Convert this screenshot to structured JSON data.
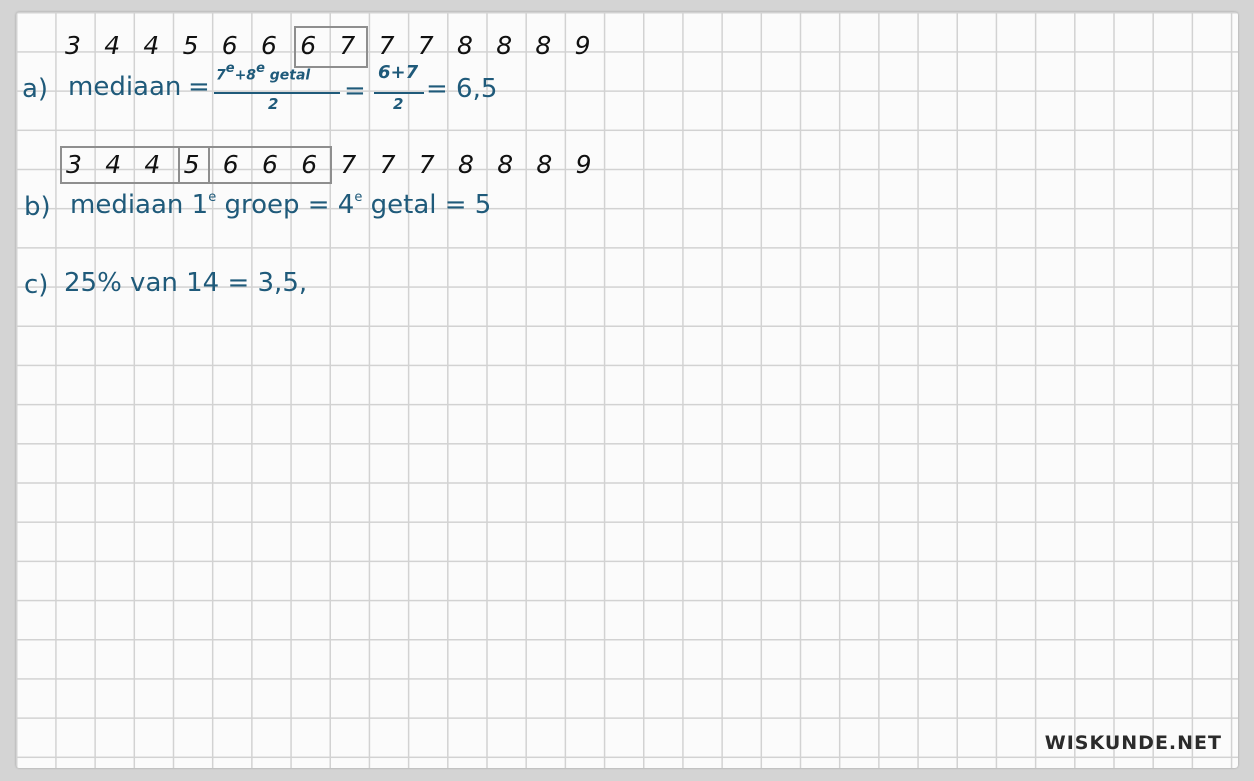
{
  "row_a_numbers": [
    "3",
    "4",
    "4",
    "5",
    "6",
    "6",
    "6",
    "7",
    "7",
    "7",
    "8",
    "8",
    "8",
    "9"
  ],
  "row_b_numbers": [
    "3",
    "4",
    "4",
    "5",
    "6",
    "6",
    "6",
    "7",
    "7",
    "7",
    "8",
    "8",
    "8",
    "9"
  ],
  "part_a": {
    "label": "a)",
    "word": "mediaan",
    "eq1": "=",
    "frac1_top": "7e + 8e getal",
    "frac1_top_parts": [
      "7",
      "e",
      "+8",
      "e",
      " getal"
    ],
    "frac1_bottom": "2",
    "eq2": "=",
    "frac2_top": "6+7",
    "frac2_bottom": "2",
    "result": "= 6,5"
  },
  "part_b": {
    "label": "b)",
    "word1": "mediaan 1",
    "sup1": "e",
    "word2": " groep = 4",
    "sup2": "e",
    "word3": " getal = 5"
  },
  "part_c": {
    "label": "c)",
    "text": "25% van 14 = 3,5,"
  },
  "watermark": "WISKUNDE.NET",
  "colors": {
    "ink_blue": "#1f5a7a",
    "ink_black": "#111111",
    "grid": "#d2d2d2",
    "box": "#8e8e8e"
  }
}
